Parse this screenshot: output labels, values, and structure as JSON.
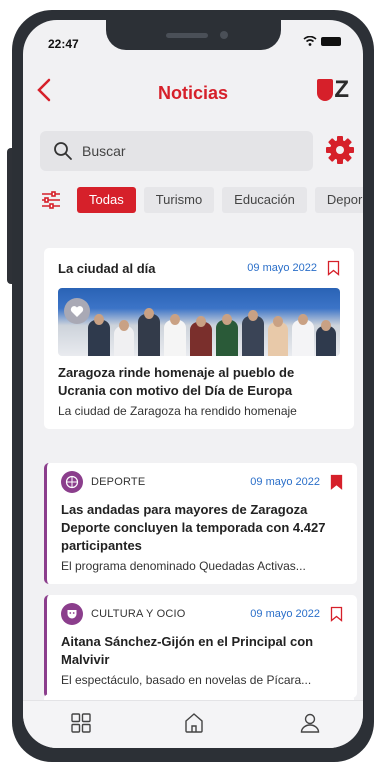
{
  "status_bar": {
    "time": "22:47"
  },
  "header": {
    "title": "Noticias",
    "logo_text": "Z"
  },
  "search": {
    "placeholder": "Buscar"
  },
  "filters": [
    "Todas",
    "Turismo",
    "Educación",
    "Depor"
  ],
  "articles": [
    {
      "title": "La ciudad al día",
      "date": "09 mayo 2022",
      "headline": "Zaragoza rinde homenaje al pueblo de Ucrania con motivo del Día de Europa",
      "summary": "La ciudad de Zaragoza ha rendido homenaje",
      "bookmarked": false
    },
    {
      "category": "DEPORTE",
      "date": "09 mayo 2022",
      "headline": "Las andadas para mayores de Zaragoza Deporte concluyen la temporada con 4.427 participantes",
      "summary": "El programa denominado Quedadas Activas...",
      "bookmarked": true
    },
    {
      "category": "CULTURA Y OCIO",
      "date": "09 mayo 2022",
      "headline": "Aitana Sánchez-Gijón en el Principal con Malvivir",
      "summary": "El espectáculo, basado en novelas de Pícara...",
      "bookmarked": false
    }
  ],
  "colors": {
    "accent": "#d6202a",
    "category": "#8b3e8c",
    "date": "#2b6fc9"
  },
  "tab_icons": [
    "grid-icon",
    "home-icon",
    "user-icon"
  ]
}
